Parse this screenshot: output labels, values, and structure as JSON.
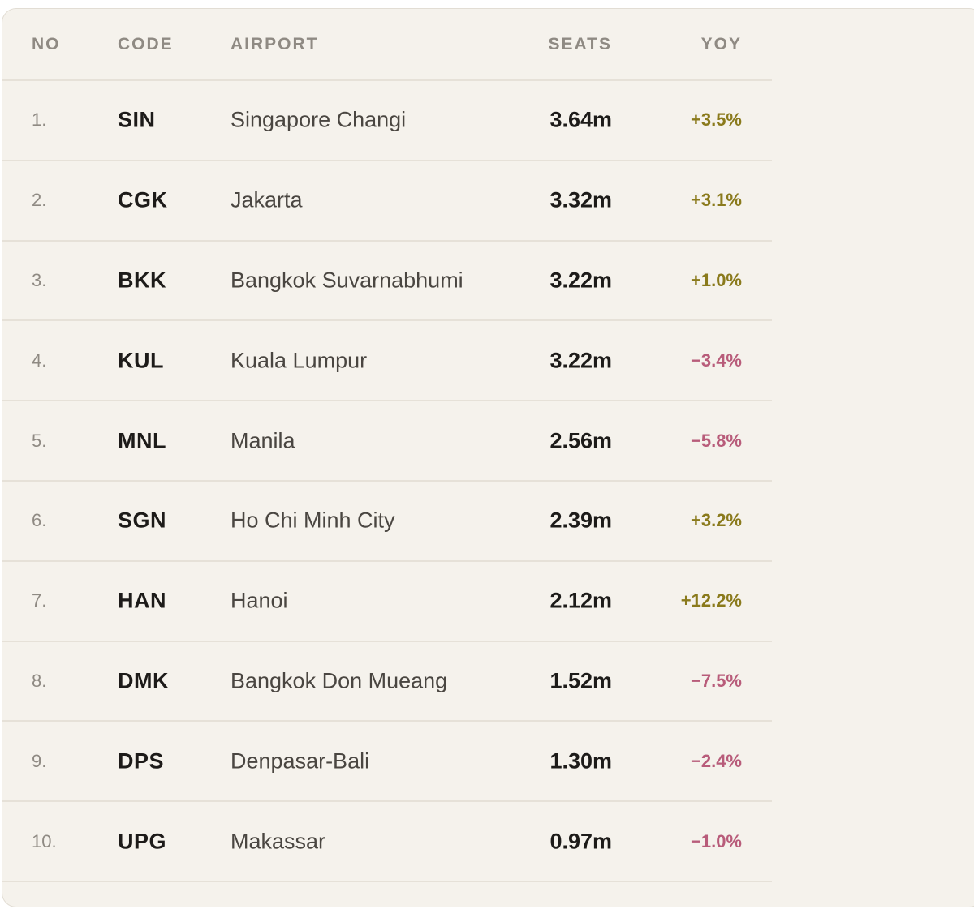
{
  "table": {
    "headers": {
      "no": "NO",
      "code": "CODE",
      "airport": "AIRPORT",
      "seats": "SEATS",
      "yoy": "YOY"
    },
    "rows": [
      {
        "no": "1.",
        "code": "SIN",
        "airport": "Singapore Changi",
        "seats": "3.64m",
        "yoy": "+3.5%",
        "trend": "positive"
      },
      {
        "no": "2.",
        "code": "CGK",
        "airport": "Jakarta",
        "seats": "3.32m",
        "yoy": "+3.1%",
        "trend": "positive"
      },
      {
        "no": "3.",
        "code": "BKK",
        "airport": "Bangkok Suvarnabhumi",
        "seats": "3.22m",
        "yoy": "+1.0%",
        "trend": "positive"
      },
      {
        "no": "4.",
        "code": "KUL",
        "airport": "Kuala Lumpur",
        "seats": "3.22m",
        "yoy": "−3.4%",
        "trend": "negative"
      },
      {
        "no": "5.",
        "code": "MNL",
        "airport": "Manila",
        "seats": "2.56m",
        "yoy": "−5.8%",
        "trend": "negative"
      },
      {
        "no": "6.",
        "code": "SGN",
        "airport": "Ho Chi Minh City",
        "seats": "2.39m",
        "yoy": "+3.2%",
        "trend": "positive"
      },
      {
        "no": "7.",
        "code": "HAN",
        "airport": "Hanoi",
        "seats": "2.12m",
        "yoy": "+12.2%",
        "trend": "positive"
      },
      {
        "no": "8.",
        "code": "DMK",
        "airport": "Bangkok Don Mueang",
        "seats": "1.52m",
        "yoy": "−7.5%",
        "trend": "negative"
      },
      {
        "no": "9.",
        "code": "DPS",
        "airport": "Denpasar-Bali",
        "seats": "1.30m",
        "yoy": "−2.4%",
        "trend": "negative"
      },
      {
        "no": "10.",
        "code": "UPG",
        "airport": "Makassar",
        "seats": "0.97m",
        "yoy": "−1.0%",
        "trend": "negative"
      }
    ]
  },
  "colors": {
    "background": "#f5f2ec",
    "positive": "#8a7a1c",
    "negative": "#b85c7a"
  }
}
